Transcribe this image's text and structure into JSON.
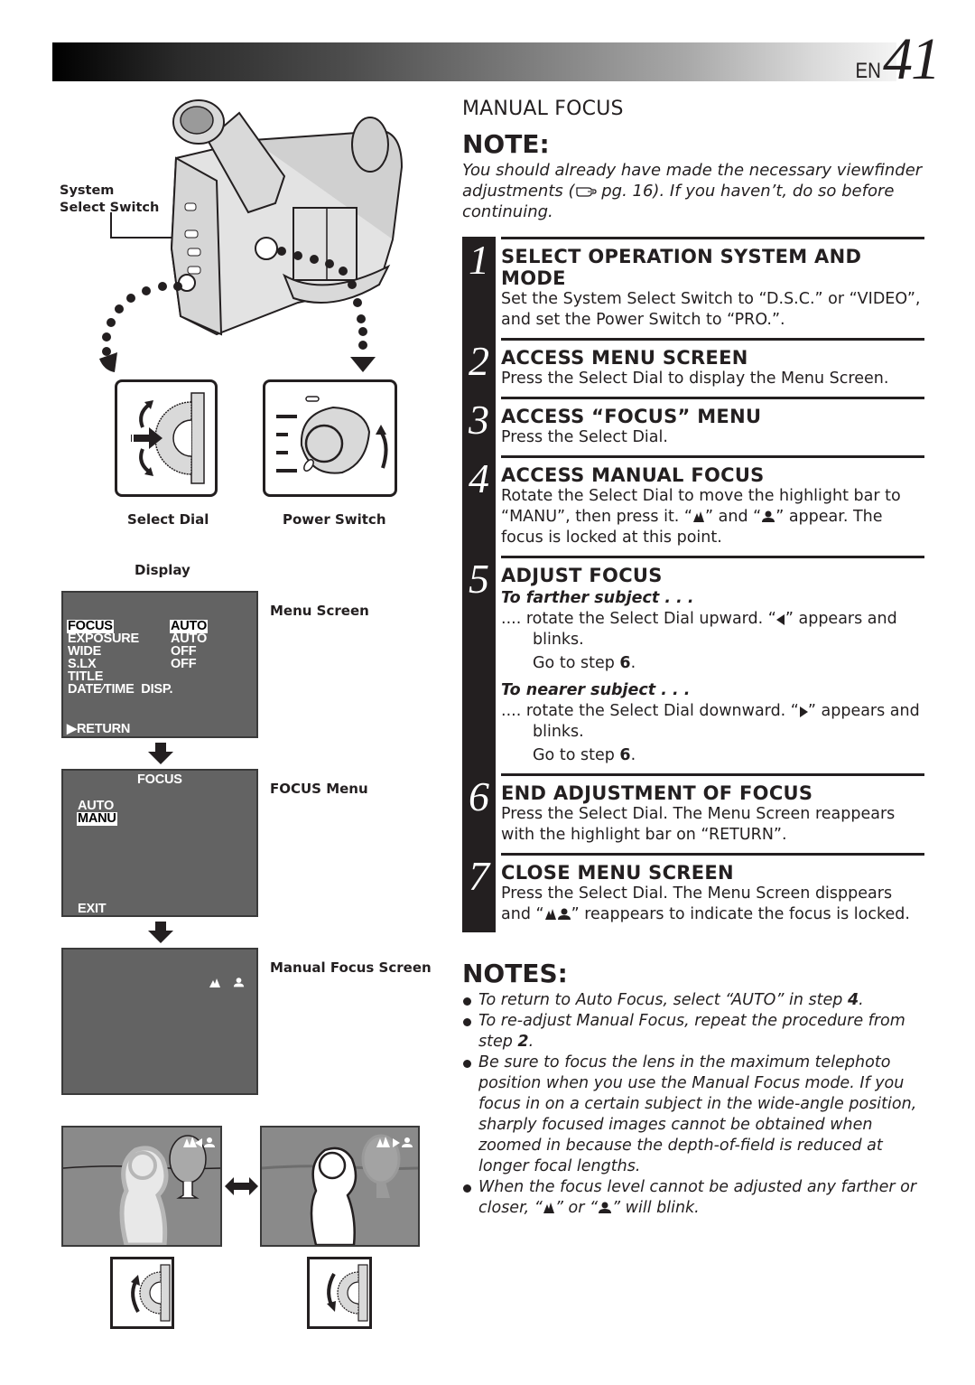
{
  "header": {
    "lang": "EN",
    "page_number": "41"
  },
  "section_title": "MANUAL FOCUS",
  "note": {
    "title": "NOTE:",
    "text_before_ref": "You should already have made the necessary viewfinder adjustments (",
    "ref_icon": "pointing-hand-icon",
    "text_after_ref": " pg. 16). If you haven’t, do so before continuing."
  },
  "steps": [
    {
      "number": "1",
      "title": "SELECT OPERATION SYSTEM AND MODE",
      "text": "Set the System Select Switch to “D.S.C.” or “VIDEO”, and set the Power Switch to “PRO.”."
    },
    {
      "number": "2",
      "title": "ACCESS MENU SCREEN",
      "text": "Press the Select Dial to display the Menu Screen."
    },
    {
      "number": "3",
      "title": "ACCESS “FOCUS” MENU",
      "text": "Press the Select Dial."
    },
    {
      "number": "4",
      "title": "ACCESS MANUAL FOCUS",
      "text_a": "Rotate the Select Dial to move the highlight bar to “MANU”, then press it. “",
      "text_b": "” and “",
      "text_c": "” appear. The focus is locked at this point.",
      "icons": [
        "far-focus-icon",
        "near-focus-icon"
      ]
    },
    {
      "number": "5",
      "title": "ADJUST FOCUS",
      "farther": {
        "title": "To farther subject . . .",
        "line_a": ".... rotate the Select Dial upward. “",
        "line_b": "” appears and blinks.",
        "icon": "left-triangle-icon",
        "goto_text": "Go to step ",
        "goto_step": "6",
        "goto_end": "."
      },
      "nearer": {
        "title": "To nearer subject . . .",
        "line_a": ".... rotate the Select Dial downward. “",
        "line_b": "” appears and blinks.",
        "icon": "right-triangle-icon",
        "goto_text": "Go to step ",
        "goto_step": "6",
        "goto_end": "."
      }
    },
    {
      "number": "6",
      "title": "END ADJUSTMENT OF FOCUS",
      "text": "Press the Select Dial. The Menu Screen reappears with the highlight bar on “RETURN”."
    },
    {
      "number": "7",
      "title": "CLOSE MENU SCREEN",
      "text_a": "Press the Select Dial. The Menu Screen disppears and “",
      "text_b": "” reappears to indicate the focus is locked."
    }
  ],
  "notes": {
    "title": "NOTES:",
    "items": [
      {
        "text_a": "To return to Auto Focus, select “AUTO” in step ",
        "bold": "4",
        "text_b": "."
      },
      {
        "text_a": "To re-adjust Manual Focus, repeat the procedure from step ",
        "bold": "2",
        "text_b": "."
      },
      {
        "text_a": "Be sure to focus the lens in the maximum telephoto position when you use the Manual Focus mode. If you focus in on a certain subject in the wide-angle position, sharply focused images cannot be obtained when zoomed in because the depth-of-field is reduced at longer focal lengths.",
        "bold": "",
        "text_b": ""
      },
      {
        "text_a": "When the focus level cannot be adjusted any farther or closer, “",
        "mid": "” or “",
        "text_b": "” will blink."
      }
    ]
  },
  "illustration": {
    "system_select_label_1": "System",
    "system_select_label_2": "Select Switch",
    "select_dial_label": "Select Dial",
    "power_switch_label": "Power Switch",
    "display_label": "Display",
    "menu_screen": {
      "caption": "Menu Screen",
      "rows": [
        {
          "item": "FOCUS",
          "value": "AUTO",
          "highlighted": true
        },
        {
          "item": "EXPOSURE",
          "value": "AUTO"
        },
        {
          "item": "WIDE",
          "value": "OFF"
        },
        {
          "item": "S.LX",
          "value": "OFF"
        },
        {
          "item": "TITLE",
          "value": ""
        },
        {
          "item": "DATE∕TIME  DISP.",
          "value": ""
        }
      ],
      "return_label": "▶RETURN"
    },
    "focus_menu": {
      "caption": "FOCUS Menu",
      "title": "FOCUS",
      "options": [
        "AUTO",
        "MANU"
      ],
      "selected": "MANU",
      "exit_label": "EXIT"
    },
    "manual_focus_screen": {
      "caption": "Manual Focus Screen",
      "icons": [
        "far-focus-icon",
        "near-focus-icon"
      ]
    },
    "compare_icon": "double-arrow-icon"
  },
  "colors": {
    "ink": "#231f20",
    "screen_bg": "#636363",
    "panel_fill": "#d9d9d9"
  }
}
